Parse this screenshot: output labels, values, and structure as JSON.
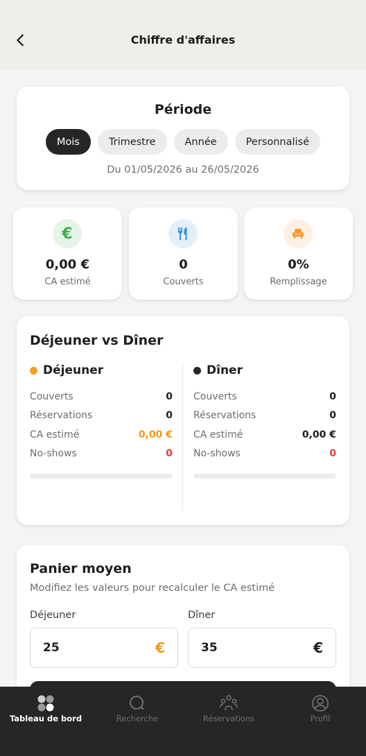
{
  "header": {
    "title": "Chiffre d'affaires",
    "back_icon": "chevron-left-icon"
  },
  "period": {
    "title": "Période",
    "chips": [
      {
        "label": "Mois",
        "active": true
      },
      {
        "label": "Trimestre",
        "active": false
      },
      {
        "label": "Année",
        "active": false
      },
      {
        "label": "Personnalisé",
        "active": false
      }
    ],
    "range": "Du 01/05/2026 au 26/05/2026"
  },
  "stats": [
    {
      "icon": "euro-icon",
      "value": "0,00 €",
      "label": "CA estimé",
      "icon_color": "#3fae4f",
      "icon_bg": "#e4f4e6"
    },
    {
      "icon": "cutlery-icon",
      "value": "0",
      "label": "Couverts",
      "icon_color": "#2b8fe3",
      "icon_bg": "#e3f0fb"
    },
    {
      "icon": "armchair-icon",
      "value": "0%",
      "label": "Remplissage",
      "icon_color": "#f59a23",
      "icon_bg": "#fdf0e3"
    }
  ],
  "comparison": {
    "title": "Déjeuner vs Dîner",
    "lunch": {
      "title": "Déjeuner",
      "dot_color": "#f5a11b",
      "rows": [
        {
          "label": "Couverts",
          "value": "0"
        },
        {
          "label": "Réservations",
          "value": "0"
        },
        {
          "label": "CA estimé",
          "value": "0,00 €"
        },
        {
          "label": "No-shows",
          "value": "0"
        }
      ],
      "progress": 0
    },
    "dinner": {
      "title": "Dîner",
      "dot_color": "#262626",
      "rows": [
        {
          "label": "Couverts",
          "value": "0"
        },
        {
          "label": "Réservations",
          "value": "0"
        },
        {
          "label": "CA estimé",
          "value": "0,00 €"
        },
        {
          "label": "No-shows",
          "value": "0"
        }
      ],
      "progress": 0
    }
  },
  "basket": {
    "title": "Panier moyen",
    "subtitle": "Modifiez les valeurs pour recalculer le CA estimé",
    "lunch": {
      "label": "Déjeuner",
      "value": "25",
      "currency": "€",
      "currency_color": "#f39a12"
    },
    "dinner": {
      "label": "Dîner",
      "value": "35",
      "currency": "€",
      "currency_color": "#1e1e1e"
    }
  },
  "nav": {
    "items": [
      {
        "label": "Tableau de bord",
        "icon": "dashboard-icon",
        "active": true
      },
      {
        "label": "Recherche",
        "icon": "search-icon",
        "active": false
      },
      {
        "label": "Réservations",
        "icon": "people-icon",
        "active": false
      },
      {
        "label": "Profil",
        "icon": "profile-icon",
        "active": false
      }
    ]
  }
}
